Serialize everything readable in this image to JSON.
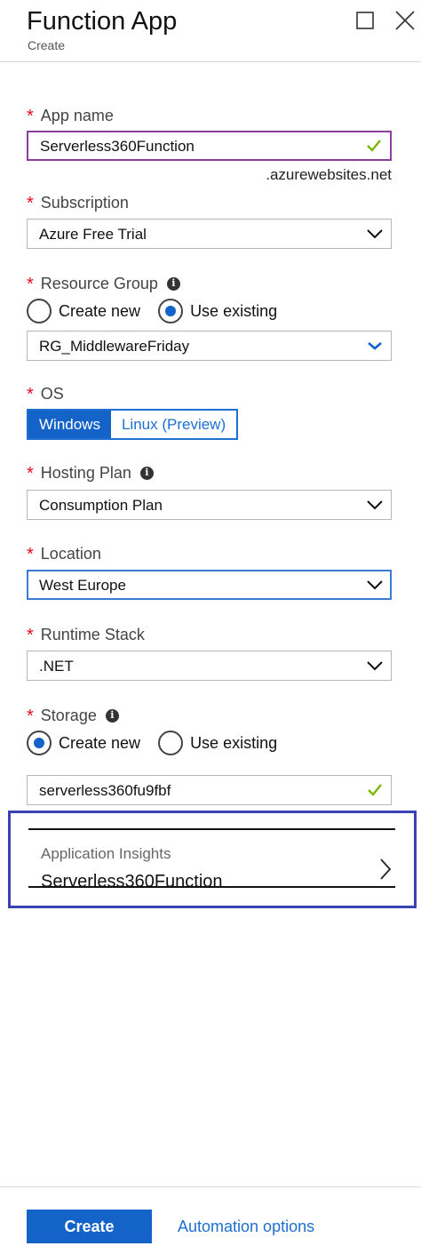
{
  "header": {
    "title": "Function App",
    "subtitle": "Create",
    "maximize_icon": "maximize-icon",
    "close_icon": "close-icon"
  },
  "form": {
    "app_name": {
      "label": "App name",
      "value": "Serverless360Function",
      "suffix": ".azurewebsites.net"
    },
    "subscription": {
      "label": "Subscription",
      "value": "Azure Free Trial"
    },
    "resource_group": {
      "label": "Resource Group",
      "radio_create": "Create new",
      "radio_existing": "Use existing",
      "selected": "Use existing",
      "value": "RG_MiddlewareFriday"
    },
    "os": {
      "label": "OS",
      "options": [
        "Windows",
        "Linux (Preview)"
      ],
      "selected": "Windows"
    },
    "hosting_plan": {
      "label": "Hosting Plan",
      "value": "Consumption Plan"
    },
    "location": {
      "label": "Location",
      "value": "West Europe"
    },
    "runtime_stack": {
      "label": "Runtime Stack",
      "value": ".NET"
    },
    "storage": {
      "label": "Storage",
      "radio_create": "Create new",
      "radio_existing": "Use existing",
      "selected": "Create new",
      "value": "serverless360fu9fbf"
    },
    "application_insights": {
      "label": "Application Insights",
      "value": "Serverless360Function"
    }
  },
  "footer": {
    "create_label": "Create",
    "automation_label": "Automation options"
  },
  "colors": {
    "accent": "#1463c8",
    "required": "#e00b1c",
    "valid_check": "#7ab800",
    "highlight_border": "#3a41b0"
  }
}
